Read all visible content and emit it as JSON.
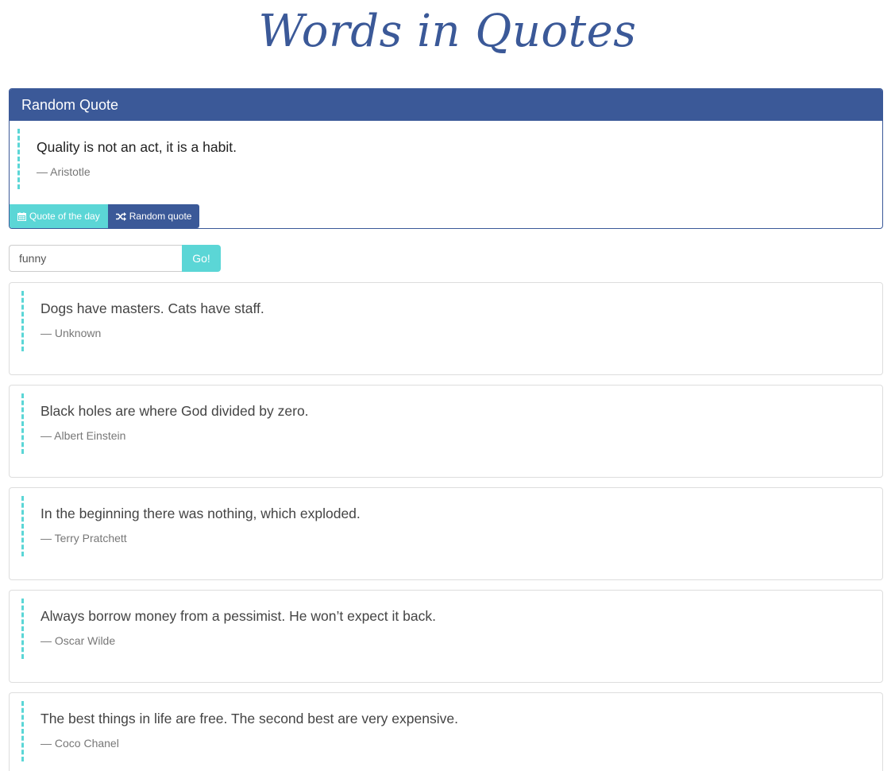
{
  "site": {
    "title": "Words in Quotes"
  },
  "random_panel": {
    "heading": "Random Quote",
    "quote": {
      "text": "Quality is not an act, it is a habit.",
      "author": "— Aristotle"
    },
    "buttons": {
      "quote_of_day": "Quote of the day",
      "random_quote": "Random quote"
    },
    "icons": {
      "quote_of_day": "calendar-icon",
      "random_quote": "shuffle-icon"
    }
  },
  "search": {
    "value": "funny",
    "button_label": "Go!"
  },
  "results": [
    {
      "text": "Dogs have masters. Cats have staff.",
      "author": "— Unknown"
    },
    {
      "text": "Black holes are where God divided by zero.",
      "author": "— Albert Einstein"
    },
    {
      "text": "In the beginning there was nothing, which exploded.",
      "author": "— Terry Pratchett"
    },
    {
      "text": "Always borrow money from a pessimist. He won’t expect it back.",
      "author": "— Oscar Wilde"
    },
    {
      "text": "The best things in life are free. The second best are very expensive.",
      "author": "— Coco Chanel"
    }
  ],
  "colors": {
    "brand": "#3b5998",
    "accent": "#5bd6d6"
  }
}
